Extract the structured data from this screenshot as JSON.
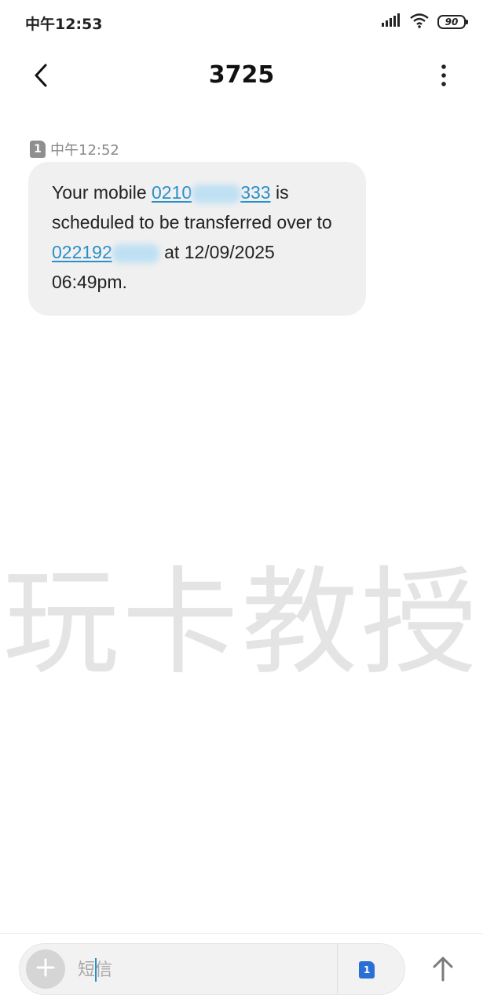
{
  "status_bar": {
    "time": "中午12:53",
    "battery_level": "90"
  },
  "header": {
    "title": "3725"
  },
  "message": {
    "sim_slot": "1",
    "timestamp": "中午12:52",
    "text_part1": "Your mobile ",
    "link1_visible_start": "0210",
    "link1_visible_end": "333",
    "text_part2": " is scheduled to be transferred over to ",
    "link2_visible_start": "022192",
    "text_part3": " at 12/09/2025 06:49pm."
  },
  "watermark": {
    "text": "玩卡教授"
  },
  "composer": {
    "placeholder": "短信",
    "sim_slot": "1"
  },
  "colors": {
    "link": "#2a8fc9",
    "bubble": "#f0f0f0",
    "sim_select": "#2a6fd6"
  }
}
